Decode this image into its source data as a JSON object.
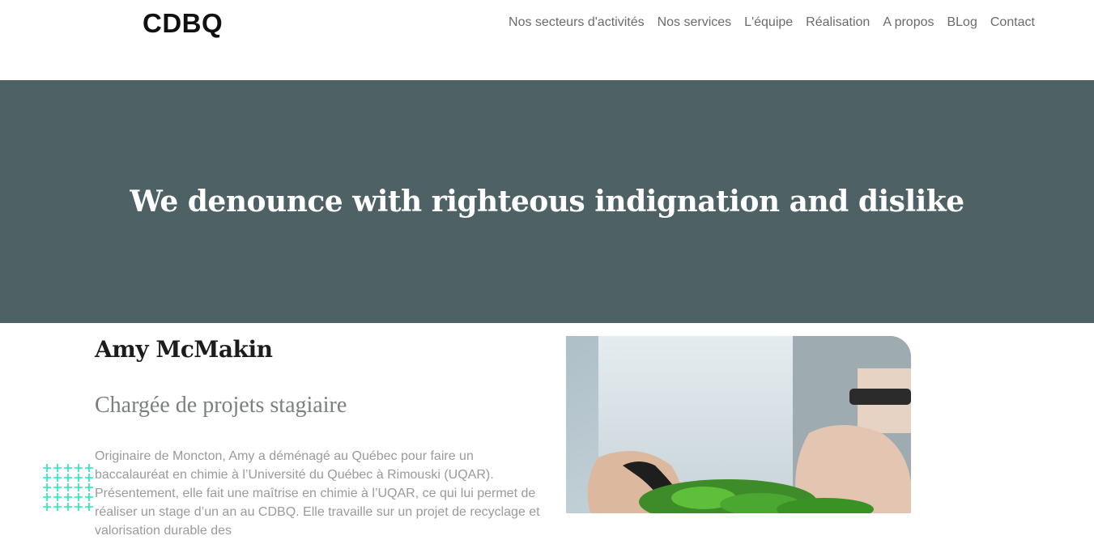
{
  "header": {
    "logo": "CDBQ",
    "nav": [
      "Nos secteurs d'activités",
      "Nos services",
      "L'équipe",
      "Réalisation",
      "A propos",
      "BLog",
      "Contact"
    ]
  },
  "hero": {
    "title": "We denounce with righteous indignation and dislike",
    "background_color": "#4e6266"
  },
  "profile": {
    "name": "Amy McMakin",
    "role": "Chargée de projets stagiaire",
    "bio": "Originaire de Moncton, Amy a déménagé au Québec pour faire un baccalauréat en chimie à l’Université du Québec à Rimouski (UQAR). Présentement, elle fait une maîtrise en chimie à l’UQAR, ce qui lui permet de réaliser un stage d’un an au CDBQ. Elle travaille sur un projet de recyclage et valorisation durable des",
    "decoration_icon": "plus-pattern",
    "accent_color": "#1de9b6"
  }
}
